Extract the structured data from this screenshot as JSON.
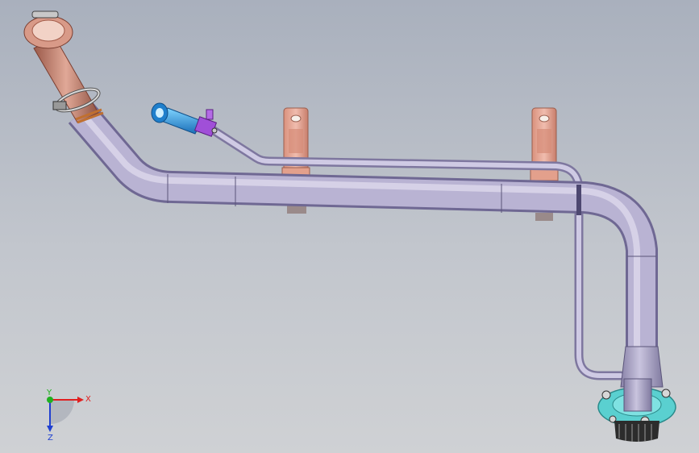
{
  "viewport": {
    "triad": {
      "x_label": "X",
      "y_label": "Y",
      "z_label": "Z",
      "x_color": "#e02020",
      "y_color": "#20b020",
      "z_color": "#2040d0"
    }
  },
  "colors": {
    "pipe": "#b9b3d3",
    "pipe_shade": "#8a83a9",
    "rubber_hose": "#c98a78",
    "bracket": "#e6a896",
    "blue_fitting": "#2ea8e8",
    "purple_clip": "#a04fd8",
    "flange": "#5ad0d0",
    "background_top": "#a9b0bd",
    "background_bottom": "#cfd1d4"
  },
  "icons": {
    "triad": "coordinate-triad-icon"
  }
}
